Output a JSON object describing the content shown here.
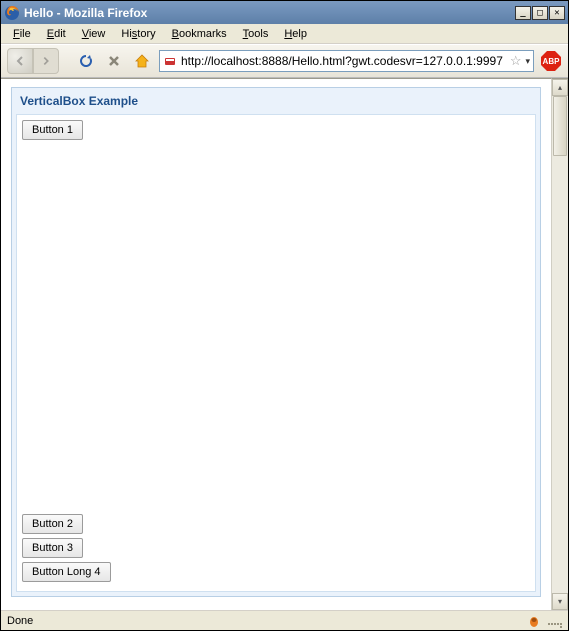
{
  "window": {
    "title": "Hello - Mozilla Firefox",
    "minimize_icon": "_",
    "maximize_icon": "□",
    "close_icon": "✕"
  },
  "menubar": {
    "items": [
      {
        "label": "File",
        "accel": "F"
      },
      {
        "label": "Edit",
        "accel": "E"
      },
      {
        "label": "View",
        "accel": "V"
      },
      {
        "label": "History",
        "accel": "s"
      },
      {
        "label": "Bookmarks",
        "accel": "B"
      },
      {
        "label": "Tools",
        "accel": "T"
      },
      {
        "label": "Help",
        "accel": "H"
      }
    ]
  },
  "toolbar": {
    "url": "http://localhost:8888/Hello.html?gwt.codesvr=127.0.0.1:9997",
    "abp_label": "ABP"
  },
  "page": {
    "panel_title": "VerticalBox Example",
    "buttons": {
      "top": [
        "Button 1"
      ],
      "bottom": [
        "Button 2",
        "Button 3",
        "Button Long 4"
      ]
    }
  },
  "statusbar": {
    "text": "Done"
  }
}
